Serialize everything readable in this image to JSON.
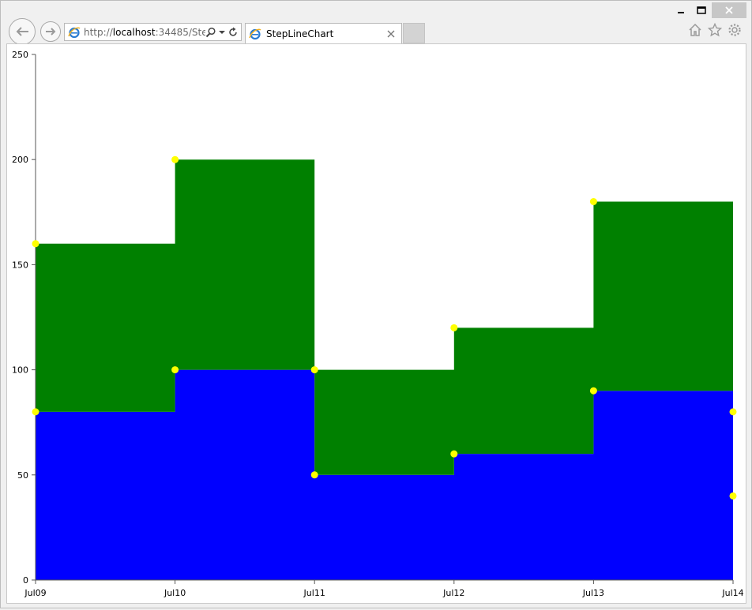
{
  "browser": {
    "address": {
      "prefix": "http://",
      "host": "localhost",
      "rest": ":34485/StepL"
    },
    "tab_title": "StepLineChart",
    "icons": [
      "back-arrow-icon",
      "forward-arrow-icon",
      "ie-icon",
      "search-icon",
      "dropdown-icon",
      "refresh-icon",
      "close-icon",
      "home-icon",
      "star-icon",
      "gear-icon",
      "minimize-icon",
      "maximize-icon"
    ]
  },
  "chart_data": {
    "type": "area",
    "subtype": "step-area-stacked",
    "categories": [
      "Jul09",
      "Jul10",
      "Jul11",
      "Jul12",
      "Jul13",
      "Jul14"
    ],
    "ylim": [
      0,
      250
    ],
    "yticks": [
      0,
      50,
      100,
      150,
      200,
      250
    ],
    "grid": false,
    "series": [
      {
        "values": [
          80,
          100,
          50,
          60,
          90,
          40
        ],
        "color": "#0000ff"
      },
      {
        "values": [
          80,
          100,
          50,
          60,
          90,
          40
        ],
        "color": "#008000"
      }
    ],
    "top_values": [
      160,
      200,
      100,
      120,
      180,
      80
    ],
    "marker_color": "#ffff00"
  }
}
